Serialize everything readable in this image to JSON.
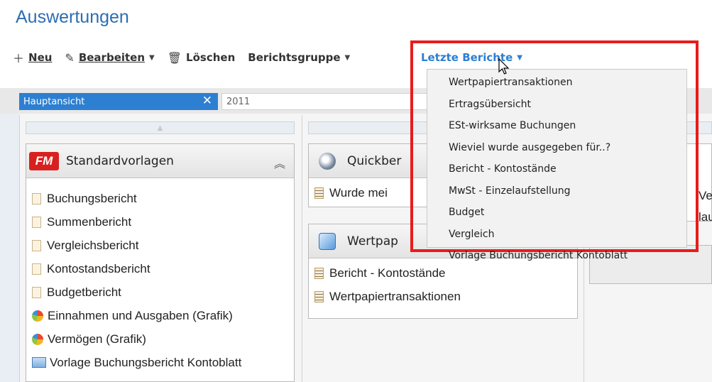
{
  "window": {
    "title": "Auswertungen"
  },
  "toolbar": {
    "new_label": "Neu",
    "edit_label": "Bearbeiten",
    "delete_label": "Löschen",
    "group_label": "Berichtsgruppe",
    "recent_label": "Letzte Berichte"
  },
  "tabs": {
    "active_label": "Hauptansicht",
    "input_value": "2011"
  },
  "panels": {
    "standard": {
      "logo_text": "FM",
      "title": "Standardvorlagen",
      "items": [
        "Buchungsbericht",
        "Summenbericht",
        "Vergleichsbericht",
        "Kontostandsbericht",
        "Budgetbericht",
        "Einnahmen und Ausgaben (Grafik)",
        "Vermögen (Grafik)",
        "Vorlage Buchungsbericht Kontoblatt"
      ]
    },
    "quick": {
      "title": "Quickber",
      "items": [
        "Wurde mei"
      ]
    },
    "wertpapier": {
      "title": "Wertpap",
      "items": [
        "Bericht - Kontostände",
        "Wertpapiertransaktionen"
      ]
    },
    "right_fragments": [
      "Ve",
      "lau"
    ]
  },
  "recent_menu": {
    "items": [
      "Wertpapiertransaktionen",
      "Ertragsübersicht",
      "ESt-wirksame Buchungen",
      "Wieviel wurde ausgegeben für..?",
      "Bericht - Kontostände",
      "MwSt - Einzelaufstellung",
      "Budget",
      "Vergleich",
      "Vorlage Buchungsbericht Kontoblatt"
    ]
  },
  "colors": {
    "accent": "#2d7fd1",
    "highlight_frame": "#e81c1c",
    "brand": "#d8211f"
  }
}
